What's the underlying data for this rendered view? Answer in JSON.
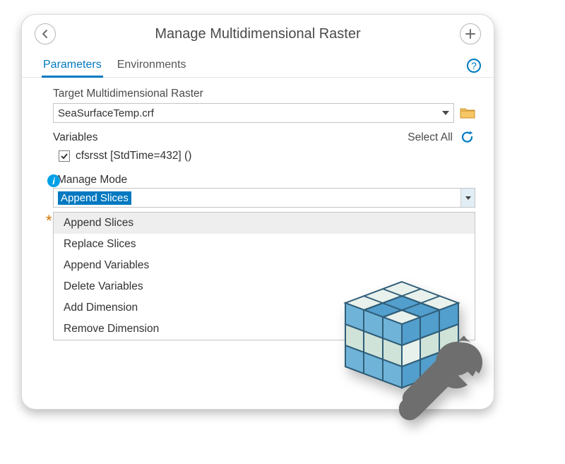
{
  "header": {
    "title": "Manage Multidimensional Raster"
  },
  "tabs": {
    "parameters": "Parameters",
    "environments": "Environments"
  },
  "target": {
    "label": "Target Multidimensional Raster",
    "value": "SeaSurfaceTemp.crf"
  },
  "variables": {
    "label": "Variables",
    "select_all": "Select All",
    "item": "cfsrsst [StdTime=432] ()"
  },
  "manage": {
    "label": "Manage Mode",
    "selected": "Append Slices",
    "options": [
      "Append Slices",
      "Replace Slices",
      "Append Variables",
      "Delete Variables",
      "Add Dimension",
      "Remove Dimension"
    ]
  }
}
